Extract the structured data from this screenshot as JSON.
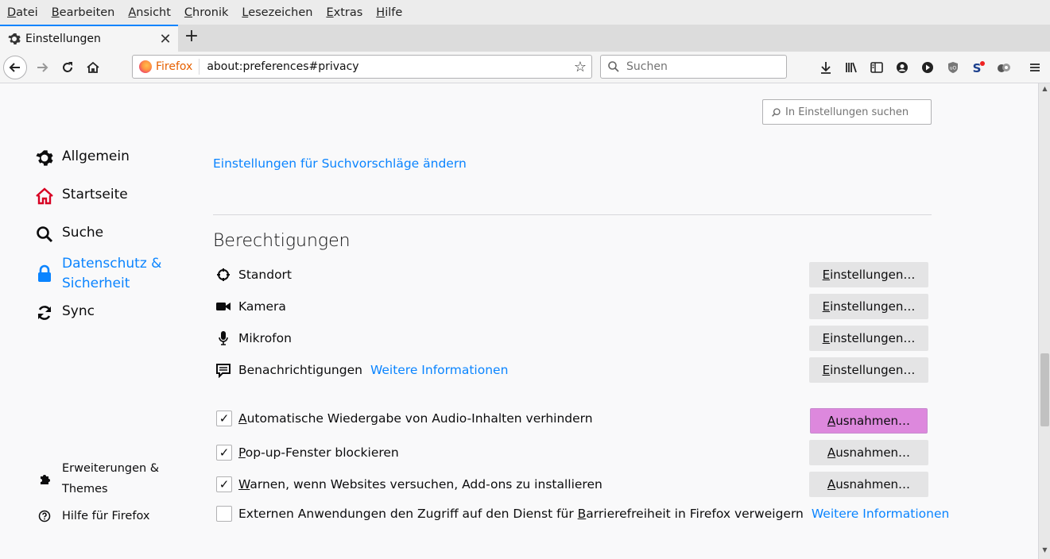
{
  "menubar": {
    "items": [
      {
        "first": "D",
        "rest": "atei"
      },
      {
        "first": "B",
        "rest": "earbeiten"
      },
      {
        "first": "A",
        "rest": "nsicht"
      },
      {
        "first": "C",
        "rest": "hronik"
      },
      {
        "first": "L",
        "rest": "esezeichen"
      },
      {
        "first": "E",
        "rest": "xtras"
      },
      {
        "first": "H",
        "rest": "ilfe"
      }
    ]
  },
  "tabs": {
    "active_title": "Einstellungen",
    "close_glyph": "✕",
    "new_tab_glyph": "+"
  },
  "navbar": {
    "identity_label": "Firefox",
    "url": "about:preferences#privacy",
    "search_placeholder": "Suchen"
  },
  "prefs": {
    "search_placeholder": "In Einstellungen suchen",
    "categories": [
      {
        "label": "Allgemein",
        "icon": "gear-icon"
      },
      {
        "label": "Startseite",
        "icon": "home-icon"
      },
      {
        "label": "Suche",
        "icon": "search-icon"
      },
      {
        "label_line1": "Datenschutz &",
        "label_line2": "Sicherheit",
        "icon": "lock-icon",
        "selected": true
      },
      {
        "label": "Sync",
        "icon": "sync-icon"
      }
    ],
    "footer": [
      {
        "label_line1": "Erweiterungen &",
        "label_line2": "Themes",
        "icon": "puzzle-icon"
      },
      {
        "label": "Hilfe für Firefox",
        "icon": "help-icon"
      }
    ],
    "suggestions_link": "Einstellungen für Suchvorschläge ändern",
    "permissions_heading": "Berechtigungen",
    "permissions": [
      {
        "label": "Standort",
        "icon": "location-icon",
        "button_first": "E",
        "button_rest": "instellungen…"
      },
      {
        "label": "Kamera",
        "icon": "camera-icon",
        "button_first": "E",
        "button_rest": "instellungen…"
      },
      {
        "label": "Mikrofon",
        "icon": "microphone-icon",
        "button_first": "E",
        "button_rest": "instellungen…"
      },
      {
        "label": "Benachrichtigungen",
        "more": "Weitere Informationen",
        "icon": "notification-icon",
        "button_first": "E",
        "button_rest": "instellungen…"
      }
    ],
    "checkboxes": [
      {
        "first": "A",
        "rest": "utomatische Wiedergabe von Audio-Inhalten verhindern",
        "checked": true,
        "button_first": "A",
        "button_rest": "usnahmen…",
        "highlighted": true
      },
      {
        "first": "P",
        "rest": "op-up-Fenster blockieren",
        "checked": true,
        "button_first": "A",
        "button_rest": "usnahmen…"
      },
      {
        "first": "W",
        "rest": "arnen, wenn Websites versuchen, Add-ons zu installieren",
        "checked": true,
        "button_first": "A",
        "button_rest": "usnahmen…"
      },
      {
        "before": "Externen Anwendungen den Zugriff auf den Dienst für ",
        "first": "B",
        "rest": "arrierefreiheit in Firefox verweigern",
        "checked": false,
        "more": "Weitere Informationen"
      }
    ],
    "check_glyph": "✓"
  },
  "colors": {
    "accent": "#0a84ff",
    "highlight_button": "#dd88dd",
    "firefox_label": "#e66000"
  }
}
